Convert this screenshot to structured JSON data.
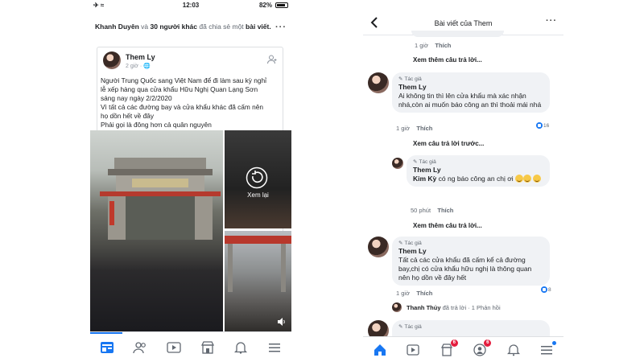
{
  "left": {
    "status": {
      "carrier": "✈ ≈",
      "time": "12:03",
      "battery": "82%"
    },
    "share_line": {
      "actor": "Khanh Duyên",
      "connector": "và",
      "others": "30 người khác",
      "action": "đã chia sẻ một",
      "object": "bài viết."
    },
    "post": {
      "author": "Them Ly",
      "time": "2 giờ · 🌐",
      "lines": [
        "Người Trung Quốc sang Việt Nam để đi làm sau kỳ nghỉ",
        "lễ xếp hàng qua cửa khẩu Hữu Nghị Quan Lạng Sơn",
        "sáng nay ngày 2/2/2020",
        "Vì tất cả các đường bay và cửa khẩu khác đã cấm nên",
        "họ dồn hết về đây",
        "Phải gọi là đông hơn cả quân nguyên"
      ],
      "replay_label": "Xem lại"
    },
    "tabs": [
      "home-icon",
      "friends-icon",
      "watch-icon",
      "marketplace-icon",
      "notifications-icon",
      "menu-icon"
    ]
  },
  "right": {
    "title": "Bài viết của Them",
    "comments": [
      {
        "time": "1 giờ",
        "like_label": "Thích"
      },
      {
        "author_tag": "Tác giả",
        "name": "Them Ly",
        "text": "Ai không tin thì lên cửa khẩu mà xác nhận nhá,còn ai muốn báo công an thì thoải mái nhá",
        "time": "1 giờ",
        "like_label": "Thích",
        "reactions": "16"
      },
      {
        "author_tag": "Tác giả",
        "name": "Them Ly",
        "mention": "Kim Kỳ",
        "text": " có ng báo công an chị ơi",
        "time": "50 phút",
        "like_label": "Thích"
      },
      {
        "author_tag": "Tác giả",
        "name": "Them Ly",
        "text": "Tất cả các cửa khẩu đã cấm kể cả đường bay,chị có cửa khẩu hữu nghị là thông quan nên họ dồn về đây hết",
        "time": "1 giờ",
        "like_label": "Thích",
        "reactions": "8"
      },
      {
        "author_tag": "Tác giả"
      }
    ],
    "see_more": {
      "more_replies_1": "Xem thêm câu trả lời...",
      "previous_replies": "Xem câu trả lời trước...",
      "more_replies_2": "Xem thêm câu trả lời..."
    },
    "reply_summary": {
      "name": "Thanh Thủy",
      "action": "đã trả lời",
      "count": "· 1 Phản hồi"
    },
    "tabbar": {
      "marketplace_badge": "6",
      "friends_badge": "6"
    }
  }
}
